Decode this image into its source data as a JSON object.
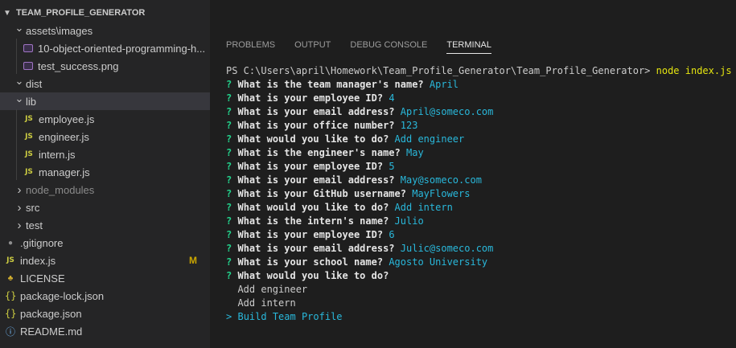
{
  "explorer": {
    "root_label": "TEAM_PROFILE_GENERATOR",
    "items": [
      {
        "label": "assets\\images",
        "type": "folder-open"
      },
      {
        "label": "10-object-oriented-programming-h...",
        "type": "image"
      },
      {
        "label": "test_success.png",
        "type": "image"
      },
      {
        "label": "dist",
        "type": "folder-open"
      },
      {
        "label": "lib",
        "type": "folder-open"
      },
      {
        "label": "employee.js",
        "type": "js"
      },
      {
        "label": "engineer.js",
        "type": "js"
      },
      {
        "label": "intern.js",
        "type": "js"
      },
      {
        "label": "manager.js",
        "type": "js"
      },
      {
        "label": "node_modules",
        "type": "folder-closed"
      },
      {
        "label": "src",
        "type": "folder-closed"
      },
      {
        "label": "test",
        "type": "folder-closed"
      },
      {
        "label": ".gitignore",
        "type": "gear"
      },
      {
        "label": "index.js",
        "type": "js",
        "badge": "M"
      },
      {
        "label": "LICENSE",
        "type": "license"
      },
      {
        "label": "package-lock.json",
        "type": "json"
      },
      {
        "label": "package.json",
        "type": "json"
      },
      {
        "label": "README.md",
        "type": "info"
      }
    ]
  },
  "panel": {
    "tabs": [
      {
        "label": "PROBLEMS"
      },
      {
        "label": "OUTPUT"
      },
      {
        "label": "DEBUG CONSOLE"
      },
      {
        "label": "TERMINAL",
        "active": true
      }
    ]
  },
  "terminal": {
    "prompt": "PS C:\\Users\\april\\Homework\\Team_Profile_Generator\\Team_Profile_Generator> ",
    "command": "node index.js",
    "qa": [
      {
        "q": "What is the team manager's name?",
        "a": "April"
      },
      {
        "q": "What is your employee ID?",
        "a": "4"
      },
      {
        "q": "What is your email address?",
        "a": "April@someco.com"
      },
      {
        "q": "What is your office number?",
        "a": "123"
      },
      {
        "q": "What would you like to do?",
        "a": "Add engineer"
      },
      {
        "q": "What is the engineer's name?",
        "a": "May"
      },
      {
        "q": "What is your employee ID?",
        "a": "5"
      },
      {
        "q": "What is your email address?",
        "a": "May@someco.com"
      },
      {
        "q": "What is your GitHub username?",
        "a": "MayFlowers"
      },
      {
        "q": "What would you like to do?",
        "a": "Add intern"
      },
      {
        "q": "What is the intern's name?",
        "a": "Julio"
      },
      {
        "q": "What is your employee ID?",
        "a": "6"
      },
      {
        "q": "What is your email address?",
        "a": "Julic@someco.com"
      },
      {
        "q": "What is your school name?",
        "a": "Agosto University"
      },
      {
        "q": "What would you like to do?",
        "a": ""
      }
    ],
    "options": [
      "Add engineer",
      "Add intern",
      "Build Team Profile"
    ],
    "selected_option": "Build Team Profile",
    "question_mark": "?",
    "pointer": ">"
  },
  "colors": {
    "question": "#23d18b",
    "answer": "#29b8db",
    "command": "#e5e510",
    "js_icon": "#cbcb41",
    "badge": "#cca700"
  }
}
